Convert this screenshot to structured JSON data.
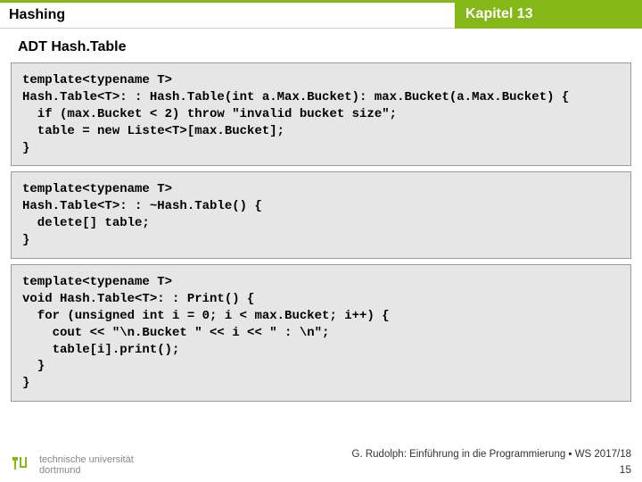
{
  "header": {
    "left": "Hashing",
    "right": "Kapitel 13"
  },
  "subtitle": "ADT Hash.Table",
  "code": {
    "block1": "template<typename T>\nHash.Table<T>: : Hash.Table(int a.Max.Bucket): max.Bucket(a.Max.Bucket) {\n  if (max.Bucket < 2) throw \"invalid bucket size\";\n  table = new Liste<T>[max.Bucket];\n}",
    "block2": "template<typename T>\nHash.Table<T>: : ~Hash.Table() {\n  delete[] table;\n}",
    "block3": "template<typename T>\nvoid Hash.Table<T>: : Print() {\n  for (unsigned int i = 0; i < max.Bucket; i++) {\n    cout << \"\\n.Bucket \" << i << \" : \\n\";\n    table[i].print();\n  }\n}"
  },
  "footer": {
    "logo_line1": "technische universität",
    "logo_line2": "dortmund",
    "credit": "G. Rudolph: Einführung in die Programmierung ▪ WS 2017/18",
    "page": "15"
  }
}
